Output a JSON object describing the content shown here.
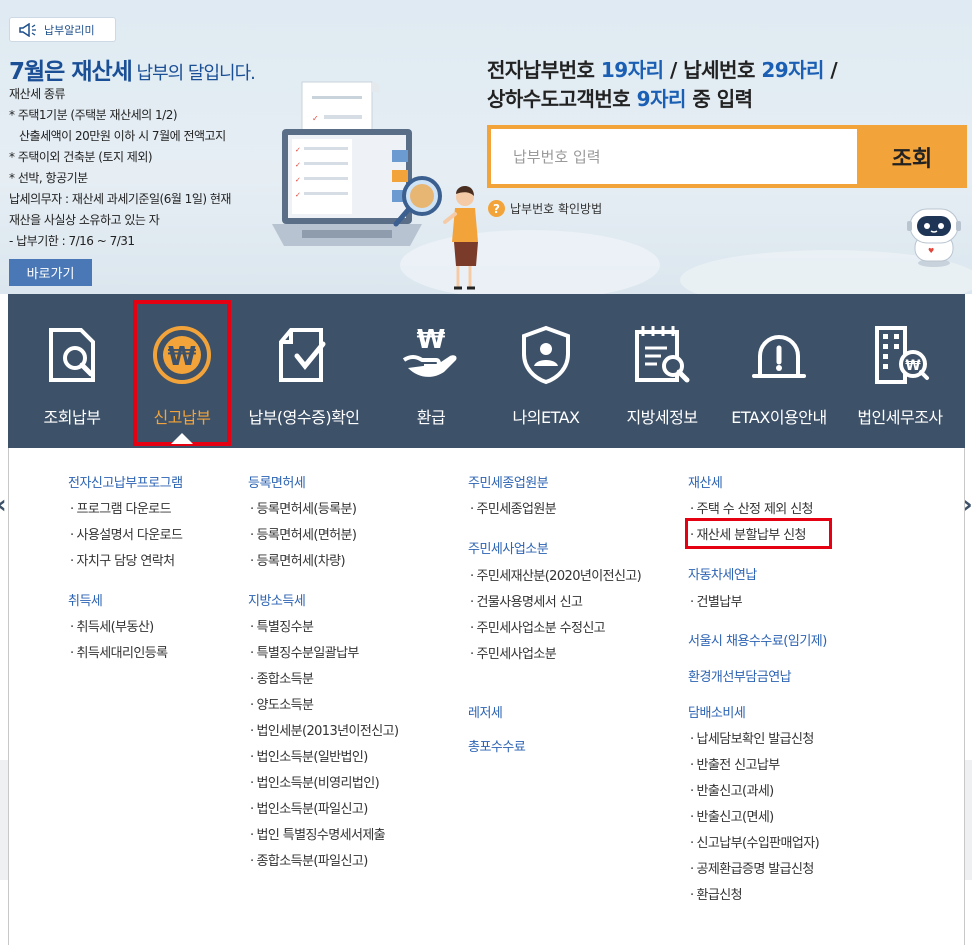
{
  "banner": {
    "badge": "납부알리미",
    "headline_main": "7월은 재산세",
    "headline_sub": " 납부의 달입니다.",
    "info_lines": [
      "재산세 종류",
      "* 주택1기분 (주택분 재산세의 1/2)",
      "  산출세액이 20만원 이하 시 7월에 전액고지",
      "* 주택이외 건축분 (토지 제외)",
      "* 선박, 항공기분",
      "납세의무자 : 재산세 과세기준일(6월 1일) 현재",
      "재산을 사실상 소유하고 있는 자",
      "- 납부기한 : 7/16 ~ 7/31"
    ],
    "goto_label": "바로가기"
  },
  "lookup": {
    "title_line1_a": "전자납부번호 ",
    "title_line1_b": "19자리",
    "title_line1_c": " / 납세번호 ",
    "title_line1_d": "29자리",
    "title_line1_e": " /",
    "title_line2_a": "상하수도고객번호 ",
    "title_line2_b": "9자리",
    "title_line2_c": " 중 입력",
    "placeholder": "납부번호 입력",
    "button": "조회",
    "help_link": "납부번호 확인방법"
  },
  "nav": {
    "items": [
      {
        "label": "조회납부",
        "icon": "search-document-icon"
      },
      {
        "label": "신고납부",
        "icon": "won-coin-icon"
      },
      {
        "label": "납부(영수증)확인",
        "icon": "check-document-icon"
      },
      {
        "label": "환급",
        "icon": "won-hand-icon"
      },
      {
        "label": "나의ETAX",
        "icon": "user-shield-icon"
      },
      {
        "label": "지방세정보",
        "icon": "info-search-icon"
      },
      {
        "label": "ETAX이용안내",
        "icon": "alarm-light-icon"
      },
      {
        "label": "법인세무조사",
        "icon": "building-won-icon"
      }
    ],
    "active_index": 1
  },
  "menu": {
    "col1": {
      "cat1": "전자신고납부프로그램",
      "cat1_items": [
        "프로그램 다운로드",
        "사용설명서 다운로드",
        "자치구 담당 연락처"
      ],
      "cat2": "취득세",
      "cat2_items": [
        "취득세(부동산)",
        "취득세대리인등록"
      ]
    },
    "col2": {
      "cat1": "등록면허세",
      "cat1_items": [
        "등록면허세(등록분)",
        "등록면허세(면허분)",
        "등록면허세(차량)"
      ],
      "cat2": "지방소득세",
      "cat2_items": [
        "특별징수분",
        "특별징수분일괄납부",
        "종합소득분",
        "양도소득분",
        "법인세분(2013년이전신고)",
        "법인소득분(일반법인)",
        "법인소득분(비영리법인)",
        "법인소득분(파일신고)",
        "법인 특별징수명세서제출",
        "종합소득분(파일신고)"
      ]
    },
    "col3": {
      "cat1": "주민세종업원분",
      "cat1_items": [
        "주민세종업원분"
      ],
      "cat2": "주민세사업소분",
      "cat2_items": [
        "주민세재산분(2020년이전신고)",
        "건물사용명세서 신고",
        "주민세사업소분 수정신고",
        "주민세사업소분"
      ],
      "cat3": "레저세",
      "cat4": "총포수수료"
    },
    "col4": {
      "cat1": "재산세",
      "cat1_items": [
        "주택 수 산정 제외 신청",
        "재산세 분할납부 신청"
      ],
      "cat2": "자동차세연납",
      "cat2_items": [
        "건별납부"
      ],
      "cat3": "서울시 채용수수료(임기제)",
      "cat4": "환경개선부담금연납",
      "cat5": "담배소비세",
      "cat5_items": [
        "납세담보확인 발급신청",
        "반출전 신고납부",
        "반출신고(과세)",
        "반출신고(면세)",
        "신고납부(수입판매업자)",
        "공제환급증명 발급신청",
        "환급신청"
      ]
    }
  },
  "colors": {
    "nav_bg": "#3d5168",
    "accent_orange": "#f2a33a",
    "link_blue": "#2c63b3",
    "highlight_red": "#e50012"
  }
}
